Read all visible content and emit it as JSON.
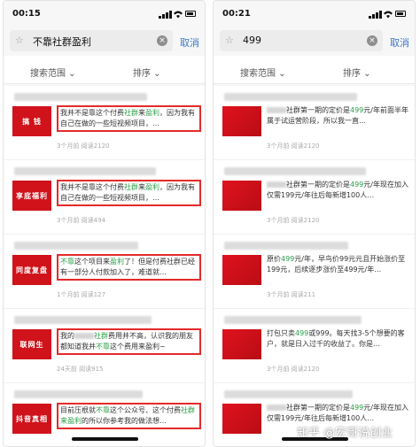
{
  "left": {
    "time": "00:15",
    "query": "不靠社群盈利",
    "cancel": "取消",
    "filter_scope": "搜索范围 ⌄",
    "filter_sort": "排序 ⌄",
    "items": [
      {
        "thumb": "搞  钱",
        "pre": "我并不是靠这个付费",
        "hl1": "社群",
        "mid": "来",
        "hl2": "盈利",
        "post": "，因为我有自己在做的一些短视频项目，…",
        "meta": "3个月前 阅读2120"
      },
      {
        "thumb": "享底福利",
        "pre": "我并不是靠这个付费",
        "hl1": "社群",
        "mid": "来",
        "hl2": "盈利",
        "post": "，因为我有自己在做的一些短视频项目，…",
        "meta": "3个月前 阅读494"
      },
      {
        "thumb": "同度复盘",
        "pre": "",
        "hl1": "不靠",
        "mid": "这个项目来",
        "hl2": "盈利",
        "post": "了！但是付费社群已经有一部分人付款加入了，难道就…",
        "meta": "1个月前 阅读127"
      },
      {
        "thumb": "联网生",
        "pre": "我的",
        "hl1": "社群",
        "mid": "费用并不高，认识我的朋友都知道我并",
        "hl2": "不靠",
        "post": "这个费用来盈利~",
        "meta": "24天前 阅读915"
      },
      {
        "thumb": "抖音真相",
        "pre": "目前压根就",
        "hl1": "不靠",
        "mid": "这个公众号、这个付费",
        "hl2": "社群来盈利",
        "post": "的所以你参考我的做法想…",
        "meta": ""
      }
    ]
  },
  "right": {
    "time": "00:21",
    "query": "499",
    "cancel": "取消",
    "filter_scope": "搜索范围 ⌄",
    "filter_sort": "排序 ⌄",
    "items": [
      {
        "pre": "社群第一期的定价是",
        "hl": "499",
        "post": "元/年前面半年属于试运营阶段，所以我一直…",
        "meta": "3个月前 阅读2120"
      },
      {
        "pre": "社群第一期的定价是",
        "hl": "499",
        "post": "元/年现在加入仅需199元/年往后每新增100人…",
        "meta": "3个月前 阅读2120"
      },
      {
        "pre": "原价",
        "hl": "499",
        "post": "元/年，早鸟价99元元且开始涨价至199元，后续逐步涨价至499元/年…",
        "meta": "3个月前 阅读211"
      },
      {
        "pre": "打包只卖",
        "hl": "499",
        "post": "或999。每天找3-5个想要的客户，就是日入过千的收益了。你是…",
        "meta": "3个月前 阅读2120"
      },
      {
        "pre": "社群第一期的定价是",
        "hl": "499",
        "post": "元/年现在加入仅需199元/年往后每新增100人…",
        "meta": ""
      }
    ]
  },
  "watermark": "知乎 @宏哥说创业",
  "colors": {
    "accent_red": "#d0121b",
    "highlight_green": "#2b9e4a",
    "cancel_blue": "#3a78c8",
    "box_border": "#e42a2a"
  },
  "icons": {
    "star": "☆",
    "clear": "×"
  }
}
